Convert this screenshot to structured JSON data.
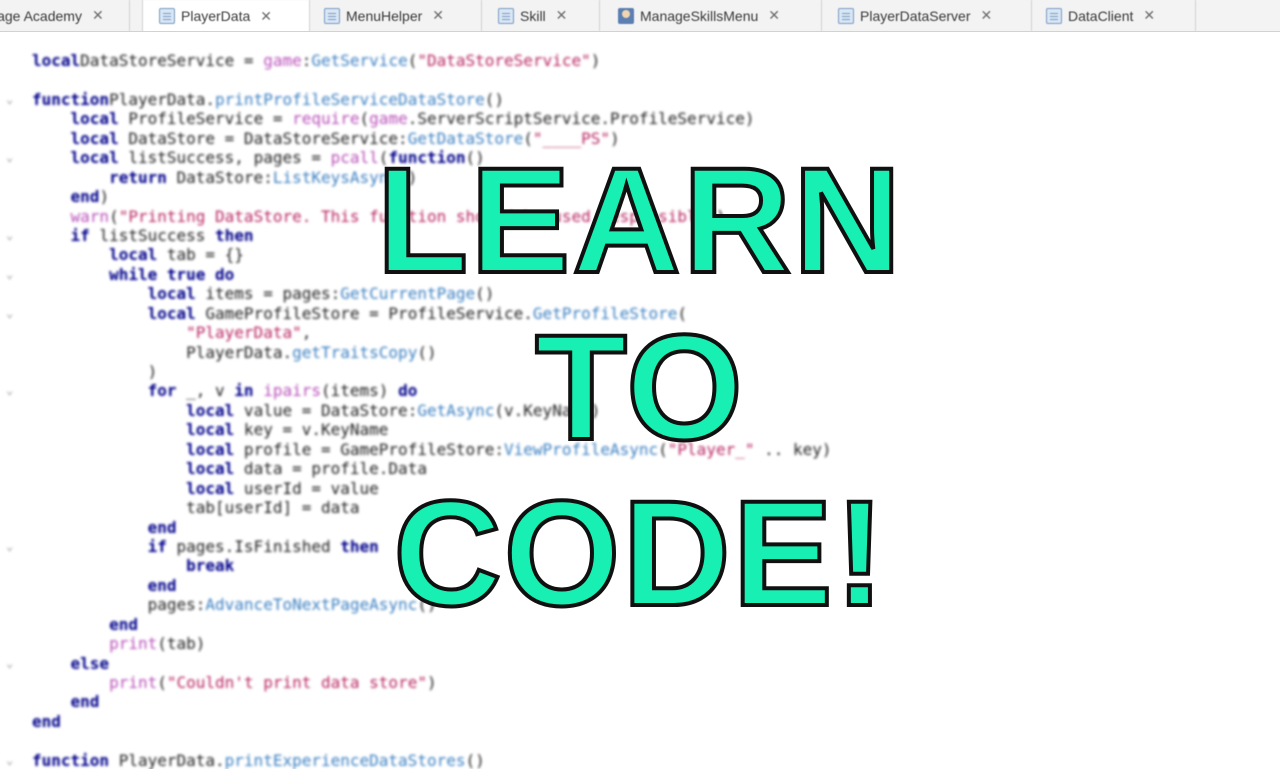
{
  "tabs": [
    {
      "label": "lage Academy",
      "icon": "script-icon",
      "active": false
    },
    {
      "label": "PlayerData",
      "icon": "script-icon",
      "active": true
    },
    {
      "label": "MenuHelper",
      "icon": "script-icon",
      "active": false
    },
    {
      "label": "Skill",
      "icon": "script-icon",
      "active": false
    },
    {
      "label": "ManageSkillsMenu",
      "icon": "local-script-icon",
      "active": false
    },
    {
      "label": "PlayerDataServer",
      "icon": "script-icon",
      "active": false
    },
    {
      "label": "DataClient",
      "icon": "script-icon",
      "active": false
    }
  ],
  "close_glyph": "✕",
  "overlay": {
    "line1": "LEARN",
    "line2": "TO",
    "line3": "CODE!",
    "fill_color": "#17f0b2",
    "stroke_color": "#101010"
  },
  "code_lines": [
    {
      "fold": "",
      "segs": [
        [
          "kw",
          "local"
        ],
        [
          "",
          "DataStoreService = "
        ],
        [
          "bi",
          "game"
        ],
        [
          "",
          ":"
        ],
        [
          "fn",
          "GetService"
        ],
        [
          "",
          "("
        ],
        [
          "str",
          "\"DataStoreService\""
        ],
        [
          "",
          ")"
        ]
      ]
    },
    {
      "fold": "",
      "segs": []
    },
    {
      "fold": "v",
      "segs": [
        [
          "kw",
          "function"
        ],
        [
          "",
          ""
        ],
        [
          "",
          "PlayerData."
        ],
        [
          "fn",
          "printProfileServiceDataStore"
        ],
        [
          "",
          "()"
        ]
      ]
    },
    {
      "fold": "",
      "segs": [
        [
          "",
          "    "
        ],
        [
          "kw",
          "local"
        ],
        [
          "",
          " ProfileService = "
        ],
        [
          "bi",
          "require"
        ],
        [
          "",
          "("
        ],
        [
          "bi",
          "game"
        ],
        [
          "",
          ".ServerScriptService.ProfileService)"
        ]
      ]
    },
    {
      "fold": "",
      "segs": [
        [
          "",
          "    "
        ],
        [
          "kw",
          "local"
        ],
        [
          "",
          " DataStore = DataStoreService:"
        ],
        [
          "fn",
          "GetDataStore"
        ],
        [
          "",
          "("
        ],
        [
          "str",
          "\"____PS\""
        ],
        [
          "",
          ")"
        ]
      ]
    },
    {
      "fold": "v",
      "segs": [
        [
          "",
          "    "
        ],
        [
          "kw",
          "local"
        ],
        [
          "",
          " listSuccess, pages = "
        ],
        [
          "bi",
          "pcall"
        ],
        [
          "",
          "("
        ],
        [
          "kw",
          "function"
        ],
        [
          "",
          "()"
        ]
      ]
    },
    {
      "fold": "",
      "segs": [
        [
          "",
          "        "
        ],
        [
          "kw",
          "return"
        ],
        [
          "",
          " DataStore:"
        ],
        [
          "fn",
          "ListKeysAsync"
        ],
        [
          "",
          "()"
        ]
      ]
    },
    {
      "fold": "",
      "segs": [
        [
          "",
          "    "
        ],
        [
          "kw",
          "end"
        ],
        [
          "",
          ")"
        ]
      ]
    },
    {
      "fold": "",
      "segs": [
        [
          "",
          "    "
        ],
        [
          "bi",
          "warn"
        ],
        [
          "",
          "("
        ],
        [
          "str",
          "\"Printing DataStore. This function should be used responsibly\""
        ],
        [
          "",
          ")"
        ]
      ]
    },
    {
      "fold": "v",
      "segs": [
        [
          "",
          "    "
        ],
        [
          "kw",
          "if"
        ],
        [
          "",
          " listSuccess "
        ],
        [
          "kw",
          "then"
        ]
      ]
    },
    {
      "fold": "",
      "segs": [
        [
          "",
          "        "
        ],
        [
          "kw",
          "local"
        ],
        [
          "",
          " tab = {}"
        ]
      ]
    },
    {
      "fold": "v",
      "segs": [
        [
          "",
          "        "
        ],
        [
          "kw",
          "while"
        ],
        [
          "",
          " "
        ],
        [
          "kw",
          "true"
        ],
        [
          "",
          " "
        ],
        [
          "kw",
          "do"
        ]
      ]
    },
    {
      "fold": "",
      "segs": [
        [
          "",
          "            "
        ],
        [
          "kw",
          "local"
        ],
        [
          "",
          " items = pages:"
        ],
        [
          "fn",
          "GetCurrentPage"
        ],
        [
          "",
          "()"
        ]
      ]
    },
    {
      "fold": "v",
      "segs": [
        [
          "",
          "            "
        ],
        [
          "kw",
          "local"
        ],
        [
          "",
          " GameProfileStore = ProfileService."
        ],
        [
          "fn",
          "GetProfileStore"
        ],
        [
          "",
          "("
        ]
      ]
    },
    {
      "fold": "",
      "segs": [
        [
          "",
          "                "
        ],
        [
          "str",
          "\"PlayerData\""
        ],
        [
          "",
          ","
        ]
      ]
    },
    {
      "fold": "",
      "segs": [
        [
          "",
          "                PlayerData."
        ],
        [
          "fn",
          "getTraitsCopy"
        ],
        [
          "",
          "()"
        ]
      ]
    },
    {
      "fold": "",
      "segs": [
        [
          "",
          "            )"
        ]
      ]
    },
    {
      "fold": "v",
      "segs": [
        [
          "",
          "            "
        ],
        [
          "kw",
          "for"
        ],
        [
          "",
          " _, v "
        ],
        [
          "kw",
          "in"
        ],
        [
          "",
          " "
        ],
        [
          "bi",
          "ipairs"
        ],
        [
          "",
          "(items) "
        ],
        [
          "kw",
          "do"
        ]
      ]
    },
    {
      "fold": "",
      "segs": [
        [
          "",
          "                "
        ],
        [
          "kw",
          "local"
        ],
        [
          "",
          " value = DataStore:"
        ],
        [
          "fn",
          "GetAsync"
        ],
        [
          "",
          "(v.KeyName)"
        ]
      ]
    },
    {
      "fold": "",
      "segs": [
        [
          "",
          "                "
        ],
        [
          "kw",
          "local"
        ],
        [
          "",
          " key = v.KeyName"
        ]
      ]
    },
    {
      "fold": "",
      "segs": [
        [
          "",
          "                "
        ],
        [
          "kw",
          "local"
        ],
        [
          "",
          " profile = GameProfileStore:"
        ],
        [
          "fn",
          "ViewProfileAsync"
        ],
        [
          "",
          "("
        ],
        [
          "str",
          "\"Player_\""
        ],
        [
          "",
          " .. key)"
        ]
      ]
    },
    {
      "fold": "",
      "segs": [
        [
          "",
          "                "
        ],
        [
          "kw",
          "local"
        ],
        [
          "",
          " data = profile.Data"
        ]
      ]
    },
    {
      "fold": "",
      "segs": [
        [
          "",
          "                "
        ],
        [
          "kw",
          "local"
        ],
        [
          "",
          " userId = value"
        ]
      ]
    },
    {
      "fold": "",
      "segs": [
        [
          "",
          "                tab[userId] = data"
        ]
      ]
    },
    {
      "fold": "",
      "segs": [
        [
          "",
          "            "
        ],
        [
          "kw",
          "end"
        ]
      ]
    },
    {
      "fold": "v",
      "segs": [
        [
          "",
          "            "
        ],
        [
          "kw",
          "if"
        ],
        [
          "",
          " pages.IsFinished "
        ],
        [
          "kw",
          "then"
        ]
      ]
    },
    {
      "fold": "",
      "segs": [
        [
          "",
          "                "
        ],
        [
          "kw",
          "break"
        ]
      ]
    },
    {
      "fold": "",
      "segs": [
        [
          "",
          "            "
        ],
        [
          "kw",
          "end"
        ]
      ]
    },
    {
      "fold": "",
      "segs": [
        [
          "",
          "            pages:"
        ],
        [
          "fn",
          "AdvanceToNextPageAsync"
        ],
        [
          "",
          "()"
        ]
      ]
    },
    {
      "fold": "",
      "segs": [
        [
          "",
          "        "
        ],
        [
          "kw",
          "end"
        ]
      ]
    },
    {
      "fold": "",
      "segs": [
        [
          "",
          "        "
        ],
        [
          "bi",
          "print"
        ],
        [
          "",
          "(tab)"
        ]
      ]
    },
    {
      "fold": "v",
      "segs": [
        [
          "",
          "    "
        ],
        [
          "kw",
          "else"
        ]
      ]
    },
    {
      "fold": "",
      "segs": [
        [
          "",
          "        "
        ],
        [
          "bi",
          "print"
        ],
        [
          "",
          "("
        ],
        [
          "str",
          "\"Couldn't print data store\""
        ],
        [
          "",
          ")"
        ]
      ]
    },
    {
      "fold": "",
      "segs": [
        [
          "",
          "    "
        ],
        [
          "kw",
          "end"
        ]
      ]
    },
    {
      "fold": "",
      "segs": [
        [
          "kw",
          "end"
        ]
      ]
    },
    {
      "fold": "",
      "segs": []
    },
    {
      "fold": "v",
      "segs": [
        [
          "kw",
          "function"
        ],
        [
          "",
          " PlayerData."
        ],
        [
          "fn",
          "printExperienceDataStores"
        ],
        [
          "",
          "()"
        ]
      ]
    }
  ]
}
